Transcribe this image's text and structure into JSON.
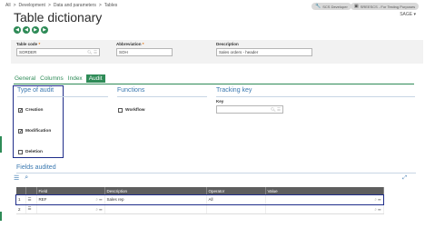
{
  "breadcrumb": [
    "All",
    ">",
    "Development",
    ">",
    "Data and parameters",
    ">",
    "Tables"
  ],
  "top_pills": {
    "developer": "SCS Developer",
    "folder": "SREESCS - For Testing Purposes"
  },
  "sage_label": "SAGE ▾",
  "page_title": "Table dictionary",
  "nav_buttons": [
    "◀",
    "◀",
    "▶",
    "▶"
  ],
  "key_fields": {
    "table_code": {
      "label": "Table code",
      "value": "SORDER"
    },
    "abbreviation": {
      "label": "Abbreviation",
      "value": "SOH"
    },
    "description": {
      "label": "Description",
      "value": "Sales orders - header"
    },
    "required_mark": "*"
  },
  "tabs": [
    "General",
    "Columns",
    "Index",
    "Audit"
  ],
  "active_tab": "Audit",
  "sections": {
    "type_of_audit": "Type of audit",
    "functions": "Functions",
    "tracking_key": "Tracking key",
    "fields_audited": "Fields audited"
  },
  "audit_types": [
    {
      "label": "Creation",
      "checked": true,
      "mark": "✓"
    },
    {
      "label": "Modification",
      "checked": true,
      "mark": "✓"
    },
    {
      "label": "Deletion",
      "checked": false,
      "mark": ""
    }
  ],
  "workflow": {
    "label": "Workflow",
    "checked": false
  },
  "tracking": {
    "key_label": "Key",
    "key_value": ""
  },
  "grid": {
    "columns": [
      "",
      "",
      "Field",
      "Description",
      "Operator",
      "Value"
    ],
    "rows": [
      {
        "num": "1",
        "field": "REF",
        "description": "Sales rep",
        "operator": "All",
        "value": ""
      },
      {
        "num": "2",
        "field": "",
        "description": "",
        "operator": "",
        "value": ""
      }
    ]
  },
  "colors": {
    "accent_green": "#2e8b57",
    "section_blue": "#3a78b0",
    "highlight_navy": "#1f2d8a",
    "grid_header": "#5e5e5e"
  }
}
